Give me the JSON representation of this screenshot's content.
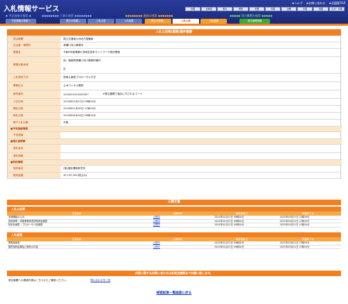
{
  "header": {
    "logo": "入札情報サービス",
    "toplinks": [
      "★ヘルプ",
      "★お問い合わせ",
      "★全国版TOP"
    ],
    "regions": [
      "全国",
      "北海道",
      "東北",
      "関東",
      "北陸",
      "中部",
      "近畿",
      "中国",
      "四国",
      "九州・沖縄",
      "沖縄",
      "国土"
    ],
    "categories": {
      "kouji_annai": "◆◆◆◆◆◆◆◆ 工事の検索 ◆◆◆◆◆◆◆◆",
      "gyomu_annai": "◆◆◆◆◆◆◆◆ 業務の検索 ◆◆◆◆◆◆◆",
      "hacchu_annai": "◆◆◆◆◆ 発注機関の検索 ◆◆◆◆◆",
      "yotei_annai": "◆ 予定価格の検索 ◆"
    },
    "tabs": [
      {
        "label": "予定価格の検索へ",
        "kind": "b"
      },
      {
        "label": "発注の見通し",
        "kind": "b"
      },
      {
        "label": "入札公告",
        "kind": "b"
      },
      {
        "label": "入札結果",
        "kind": "b"
      },
      {
        "label": "発注の見通し",
        "kind": "o"
      },
      {
        "label": "入札公告",
        "kind": "active"
      },
      {
        "label": "入札結果",
        "kind": "o"
      },
      {
        "label": "発注機関情報",
        "kind": "g"
      }
    ]
  },
  "main": {
    "title": "入札公告等(業務)案件概要",
    "rows": [
      {
        "label": "発注機関",
        "value": "国土交通省九州地方整備局"
      },
      {
        "label": "当出者・事務所",
        "value": "清瀬川河川事務所"
      },
      {
        "label": "業務名",
        "value": "令和6年度清瀬川流域生態系ネットワーク検討業務"
      },
      {
        "label": "業務対象地域",
        "value": "他：福岡県清瀬川河川事務所管内",
        "value2": "区"
      },
      {
        "label": "入札契約方式",
        "value": "簡易公募型プロポーザル方式"
      },
      {
        "label": "業務区分",
        "value": "土木コンサル業務"
      },
      {
        "label": "案件番号",
        "value": "2024003102000007",
        "note": "※発注機関で独自に付されるコード"
      },
      {
        "label": "公告日時",
        "value": "2024年01月22日 09時00分"
      },
      {
        "label": "開札日時",
        "value": "2024年01月30日 17時00分"
      },
      {
        "label": "締札日時",
        "value": "2024年04月26日 09時00分"
      },
      {
        "label": "電子入札対象",
        "value": "対象"
      }
    ],
    "subhead1": "■予定価格情報",
    "rows2": [
      {
        "label": "予定価格",
        "value": ""
      },
      {
        "label": "■落札者情報",
        "value": ""
      },
      {
        "label": "落札者名",
        "value": ""
      },
      {
        "label": "落札価格",
        "value": ""
      }
    ],
    "subhead2": "■契約情報",
    "rows3": [
      {
        "label": "契約者名",
        "value": "(株)建設環境研究所"
      },
      {
        "label": "契約金額",
        "value": "30,195,000(税込み)"
      }
    ]
  },
  "docs": {
    "title": "公開文書",
    "sec1": "入札公告等",
    "headers": [
      "文書名称",
      "公開状況",
      "最終更新日",
      "掲載終了日"
    ],
    "sec1_rows": [
      [
        "手続開始の公示",
        "公開中",
        "2024年01月22日 09時00分",
        "2025年03月31日 23時59分"
      ],
      [
        "説明書等・特殊業務書書説明書金額表",
        "公開中",
        "2024年01月22日 09時00分",
        "2025年03月31日 23時59分"
      ],
      [
        "特別仕様書・プロポーザル評価表",
        "公開中",
        "2024年01月22日 09時00分",
        "2025年03月31日 23時59分"
      ]
    ],
    "sec2": "入札経過",
    "sec2_rows": [
      [
        "業務技術書",
        "公開中",
        "2024年01月22日 09時00分",
        "2025年03月31日 23時59分"
      ],
      [
        "随意契約結果及び契約の内容",
        "公開中",
        "2024年01月22日 09時00分",
        "2025年03月31日 23時59分"
      ]
    ]
  },
  "contact": {
    "bar": "内容に関するお問い合わせは各発注機関までお願い致します。",
    "text": "発注機関への連絡先等はこちらからご確認ください。",
    "link": "問い合わせ先一覧"
  },
  "back_link": "検索結果一覧画面に戻る"
}
